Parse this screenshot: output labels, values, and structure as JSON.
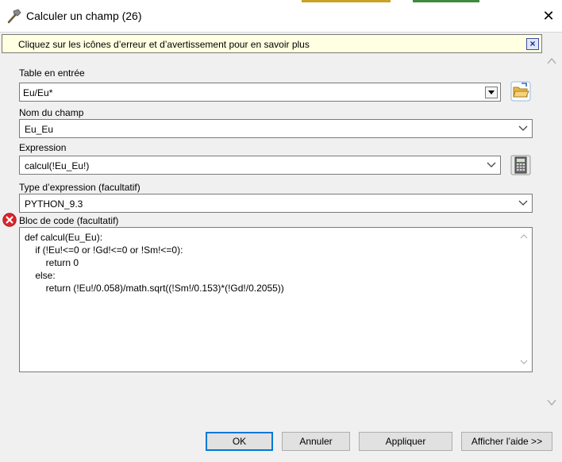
{
  "window": {
    "title": "Calculer un champ (26)",
    "close_glyph": "✕"
  },
  "info_bar": {
    "text": "Cliquez sur les icônes d’erreur et d’avertissement pour en savoir plus",
    "close_glyph": "×"
  },
  "input_table": {
    "label": "Table en entrée",
    "value": "Eu/Eu*"
  },
  "field_name": {
    "label": "Nom du champ",
    "value": "Eu_Eu"
  },
  "expression": {
    "label": "Expression",
    "value": "calcul(!Eu_Eu!)"
  },
  "expression_type": {
    "label": "Type d’expression (facultatif)",
    "value": "PYTHON_9.3"
  },
  "code_block": {
    "label": "Bloc de code (facultatif)",
    "lines": [
      "def calcul(Eu_Eu):",
      "    if (!Eu!<=0 or !Gd!<=0 or !Sm!<=0):",
      "        return 0",
      "    else:",
      "        return (!Eu!/0.058)/math.sqrt((!Sm!/0.153)*(!Gd!/0.2055))"
    ]
  },
  "buttons": {
    "ok": "OK",
    "cancel": "Annuler",
    "apply": "Appliquer",
    "help": "Afficher l’aide >>"
  },
  "icons": {
    "title": "hammer-icon",
    "browse": "folder-open-icon",
    "calculator": "calculator-icon",
    "error": "error-icon"
  },
  "colors": {
    "info_bar_bg": "#ffffe1",
    "error_red": "#d9262b",
    "default_button_border": "#0078d7"
  }
}
